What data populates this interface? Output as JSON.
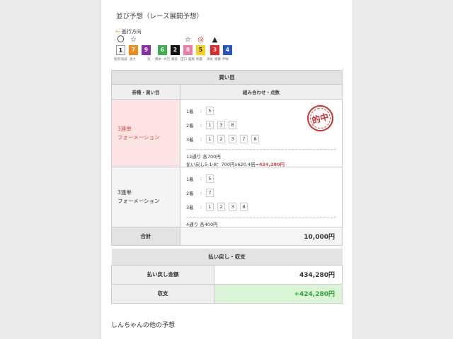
{
  "page_title": "並び予想（レース展開予想）",
  "direction_label": "進行方向",
  "marks": [
    "〇",
    "☆",
    "",
    "",
    "",
    "☆",
    "◎",
    "▲",
    ""
  ],
  "boats": [
    {
      "num": "1",
      "bg": "#ffffff",
      "fg": "#222222"
    },
    {
      "num": "7",
      "bg": "#f08a1a",
      "fg": "#ffffff"
    },
    {
      "num": "9",
      "bg": "#8a2ba8",
      "fg": "#ffffff"
    },
    {
      "num": "6",
      "bg": "#3bb04a",
      "fg": "#ffffff"
    },
    {
      "num": "2",
      "bg": "#111111",
      "fg": "#ffffff"
    },
    {
      "num": "8",
      "bg": "#f07aa0",
      "fg": "#ffffff"
    },
    {
      "num": "5",
      "bg": "#f5d31a",
      "fg": "#222222"
    },
    {
      "num": "3",
      "bg": "#e02a2a",
      "fg": "#ffffff"
    },
    {
      "num": "4",
      "bg": "#2955c4",
      "fg": "#ffffff"
    }
  ],
  "names": [
    "松岡",
    "既森",
    "渡大",
    "治",
    "橋本",
    "大内",
    "藤高",
    "田口",
    "義尾",
    "彰義",
    "清永",
    "齋藤",
    "伸裕"
  ],
  "bet_table": {
    "header": "買い目",
    "col_type": "券種・買い目",
    "col_combo": "組み合わせ・点数",
    "bets": [
      {
        "type": "3連単",
        "method": "フォーメーション",
        "rows": [
          {
            "label": "1着",
            "nums": [
              "5"
            ]
          },
          {
            "label": "2着",
            "nums": [
              "1",
              "3",
              "8"
            ]
          },
          {
            "label": "3着",
            "nums": [
              "1",
              "2",
              "3",
              "7",
              "8"
            ]
          }
        ],
        "count": "12通り 各700円",
        "payout_prefix": "払い戻し",
        "payout_detail": "5-1-8：700円x620.4倍=",
        "payout_amount": "434,280円",
        "stamp": "的中"
      },
      {
        "type": "3連単",
        "method": "フォーメーション",
        "rows": [
          {
            "label": "1着",
            "nums": [
              "5"
            ]
          },
          {
            "label": "2着",
            "nums": [
              "7"
            ]
          },
          {
            "label": "3着",
            "nums": [
              "1",
              "2",
              "3",
              "8"
            ]
          }
        ],
        "count": "4通り 各400円"
      }
    ],
    "total_label": "合計",
    "total_value": "10,000円"
  },
  "payout_table": {
    "header": "払い戻し・収支",
    "refund_label": "払い戻し金額",
    "refund_value": "434,280円",
    "balance_label": "収支",
    "balance_value": "+424,280円"
  },
  "other_predictions": "しんちゃんの他の予想",
  "colors": {
    "hit_bg": "#fde4e4",
    "hit_text": "#e04646",
    "positive_bg": "#dcf5d6",
    "positive_text": "#2ea33b",
    "arrow": "#f2a400"
  }
}
